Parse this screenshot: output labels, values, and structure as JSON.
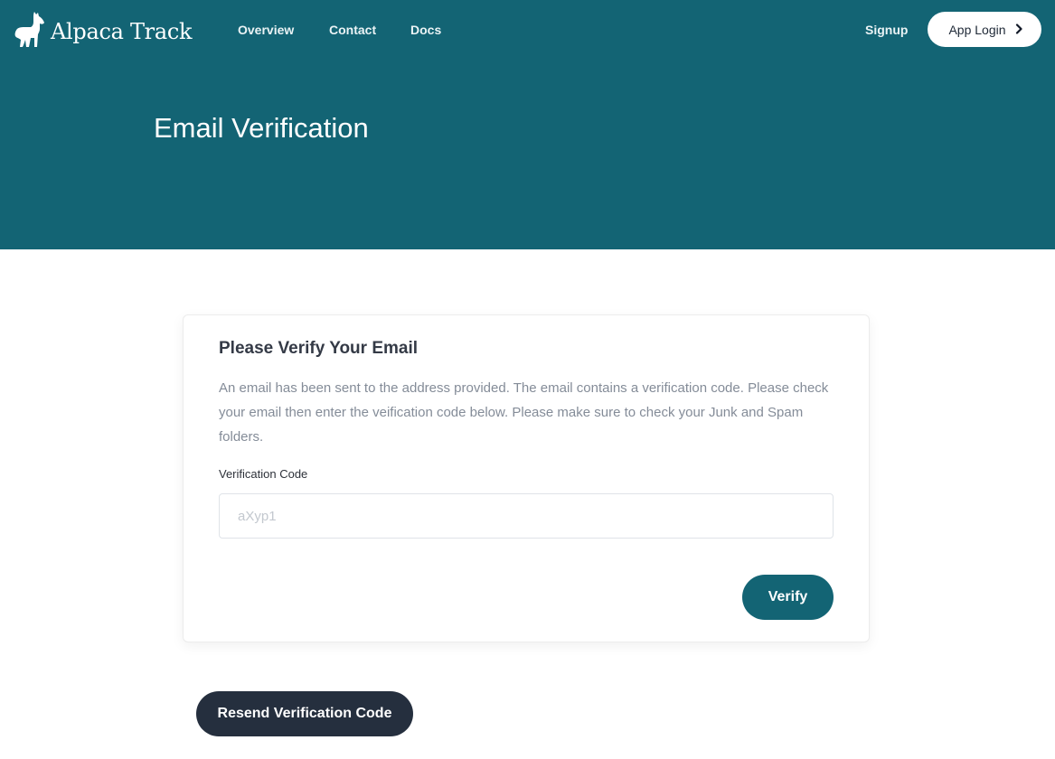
{
  "brand": {
    "name": "Alpaca Track",
    "logo_icon": "alpaca-icon"
  },
  "nav": {
    "items": [
      {
        "label": "Overview"
      },
      {
        "label": "Contact"
      },
      {
        "label": "Docs"
      }
    ],
    "signup_label": "Signup",
    "login_label": "App Login",
    "login_icon": "chevron-right-icon"
  },
  "hero": {
    "title": "Email Verification"
  },
  "card": {
    "title": "Please Verify Your Email",
    "description": "An email has been sent to the address provided. The email contains a verification code. Please check your email then enter the veification code below. Please make sure to check your Junk and Spam folders.",
    "field_label": "Verification Code",
    "field_placeholder": "aXyp1",
    "field_value": "",
    "verify_label": "Verify"
  },
  "resend_label": "Resend Verification Code",
  "colors": {
    "brand_teal": "#136474",
    "dark_button": "#252f3e",
    "white": "#ffffff"
  }
}
